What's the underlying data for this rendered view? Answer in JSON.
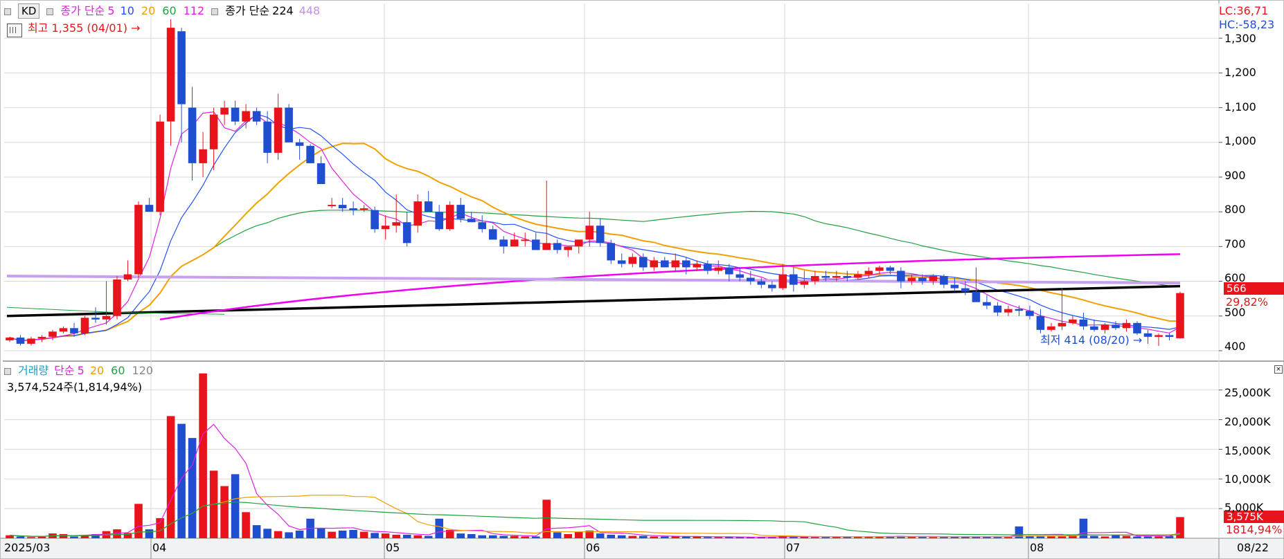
{
  "price_legend": {
    "button": "KD",
    "ma_label": "종가 단순",
    "ma_periods": [
      "5",
      "10",
      "20",
      "60",
      "112"
    ],
    "ma_colors": [
      "#e020e0",
      "#2050ff",
      "#f0a000",
      "#20a040",
      "#e020e0"
    ],
    "ma2_label": "종가 단순",
    "ma2_periods": [
      "224",
      "448"
    ]
  },
  "high_note": "최고 1,355 (04/01) →",
  "low_note": "최저 414 (08/20) →",
  "lc_text": "LC:36,71",
  "hc_text": "HC:-58,23",
  "price_tag": "566",
  "price_change": "29,82%",
  "volume_legend": {
    "label": "거래량",
    "ma_label": "단순",
    "periods": [
      "5",
      "20",
      "60",
      "120"
    ]
  },
  "volume_info": "3,574,524주(1,814,94%)",
  "volume_tag": "3,575K",
  "volume_change": "1814,94%",
  "x_axis_labels": [
    "2025/03",
    "04",
    "05",
    "06",
    "07",
    "08"
  ],
  "x_end_label": "08/22",
  "price_axis_ticks": [
    "1,300",
    "1,200",
    "1,100",
    "1,000",
    "900",
    "800",
    "700",
    "600",
    "500",
    "400"
  ],
  "volume_axis_ticks": [
    "25,000K",
    "20,000K",
    "15,000K",
    "10,000K",
    "5,000K"
  ],
  "chart_data": {
    "type": "candlestick",
    "period": "2025/03 - 08/22",
    "price_ylim": [
      370,
      1400
    ],
    "volume_ylim": [
      0,
      28000
    ],
    "ohlc_note": "approximate daily candles read from chart",
    "candles": [
      [
        430,
        440,
        425,
        438
      ],
      [
        438,
        445,
        415,
        420
      ],
      [
        420,
        440,
        415,
        435
      ],
      [
        435,
        445,
        425,
        440
      ],
      [
        440,
        460,
        430,
        455
      ],
      [
        455,
        470,
        450,
        465
      ],
      [
        465,
        480,
        440,
        450
      ],
      [
        450,
        500,
        445,
        495
      ],
      [
        495,
        525,
        480,
        490
      ],
      [
        490,
        600,
        475,
        500
      ],
      [
        500,
        615,
        490,
        605
      ],
      [
        605,
        660,
        600,
        620
      ],
      [
        620,
        830,
        610,
        820
      ],
      [
        820,
        840,
        800,
        800
      ],
      [
        800,
        1080,
        790,
        1060
      ],
      [
        1060,
        1355,
        990,
        1330
      ],
      [
        1320,
        1330,
        1000,
        1110
      ],
      [
        1100,
        1160,
        890,
        940
      ],
      [
        940,
        1030,
        900,
        980
      ],
      [
        980,
        1100,
        920,
        1080
      ],
      [
        1080,
        1120,
        1050,
        1100
      ],
      [
        1100,
        1120,
        1050,
        1060
      ],
      [
        1060,
        1110,
        1040,
        1090
      ],
      [
        1090,
        1100,
        1050,
        1060
      ],
      [
        1060,
        1090,
        940,
        970
      ],
      [
        970,
        1140,
        950,
        1100
      ],
      [
        1100,
        1110,
        1030,
        1000
      ],
      [
        1000,
        1010,
        950,
        990
      ],
      [
        990,
        995,
        940,
        940
      ],
      [
        940,
        960,
        880,
        880
      ],
      [
        820,
        840,
        810,
        820
      ],
      [
        820,
        840,
        800,
        810
      ],
      [
        810,
        830,
        790,
        805
      ],
      [
        810,
        820,
        800,
        810
      ],
      [
        805,
        815,
        740,
        750
      ],
      [
        750,
        790,
        720,
        760
      ],
      [
        760,
        850,
        740,
        770
      ],
      [
        770,
        800,
        700,
        710
      ],
      [
        760,
        850,
        740,
        830
      ],
      [
        830,
        860,
        800,
        800
      ],
      [
        800,
        820,
        745,
        750
      ],
      [
        750,
        830,
        745,
        820
      ],
      [
        820,
        840,
        770,
        780
      ],
      [
        780,
        800,
        770,
        770
      ],
      [
        770,
        790,
        740,
        750
      ],
      [
        750,
        760,
        720,
        720
      ],
      [
        720,
        730,
        680,
        700
      ],
      [
        700,
        740,
        700,
        720
      ],
      [
        720,
        740,
        700,
        720
      ],
      [
        720,
        740,
        690,
        690
      ],
      [
        690,
        890,
        690,
        710
      ],
      [
        710,
        720,
        680,
        690
      ],
      [
        690,
        700,
        670,
        700
      ],
      [
        700,
        720,
        680,
        720
      ],
      [
        720,
        800,
        700,
        760
      ],
      [
        760,
        780,
        700,
        710
      ],
      [
        710,
        720,
        650,
        660
      ],
      [
        660,
        680,
        640,
        650
      ],
      [
        650,
        680,
        640,
        670
      ],
      [
        670,
        680,
        630,
        640
      ],
      [
        640,
        670,
        630,
        660
      ],
      [
        660,
        670,
        640,
        640
      ],
      [
        640,
        680,
        630,
        660
      ],
      [
        660,
        670,
        620,
        640
      ],
      [
        640,
        660,
        630,
        650
      ],
      [
        650,
        660,
        620,
        630
      ],
      [
        630,
        660,
        620,
        640
      ],
      [
        640,
        650,
        600,
        620
      ],
      [
        620,
        640,
        600,
        610
      ],
      [
        610,
        630,
        590,
        600
      ],
      [
        600,
        610,
        580,
        590
      ],
      [
        590,
        600,
        570,
        580
      ],
      [
        580,
        650,
        575,
        620
      ],
      [
        620,
        640,
        570,
        590
      ],
      [
        590,
        630,
        580,
        600
      ],
      [
        600,
        630,
        590,
        615
      ],
      [
        615,
        630,
        600,
        610
      ],
      [
        610,
        630,
        600,
        615
      ],
      [
        615,
        630,
        600,
        610
      ],
      [
        610,
        630,
        605,
        620
      ],
      [
        620,
        640,
        610,
        630
      ],
      [
        630,
        645,
        620,
        640
      ],
      [
        640,
        645,
        620,
        630
      ],
      [
        630,
        640,
        580,
        600
      ],
      [
        600,
        620,
        590,
        610
      ],
      [
        610,
        620,
        590,
        600
      ],
      [
        600,
        620,
        590,
        615
      ],
      [
        615,
        620,
        580,
        590
      ],
      [
        590,
        610,
        570,
        580
      ],
      [
        580,
        600,
        560,
        570
      ],
      [
        570,
        640,
        550,
        540
      ],
      [
        540,
        560,
        520,
        530
      ],
      [
        530,
        540,
        500,
        510
      ],
      [
        510,
        530,
        500,
        520
      ],
      [
        520,
        530,
        500,
        515
      ],
      [
        515,
        530,
        490,
        500
      ],
      [
        500,
        520,
        450,
        460
      ],
      [
        460,
        480,
        455,
        470
      ],
      [
        470,
        580,
        460,
        480
      ],
      [
        480,
        500,
        475,
        490
      ],
      [
        490,
        510,
        460,
        470
      ],
      [
        470,
        490,
        455,
        460
      ],
      [
        460,
        480,
        450,
        475
      ],
      [
        475,
        485,
        460,
        465
      ],
      [
        465,
        490,
        455,
        480
      ],
      [
        480,
        485,
        445,
        450
      ],
      [
        450,
        460,
        420,
        440
      ],
      [
        440,
        450,
        414,
        445
      ],
      [
        445,
        450,
        430,
        440
      ],
      [
        436,
        570,
        435,
        566
      ]
    ],
    "volumes": [
      500,
      300,
      200,
      250,
      800,
      700,
      300,
      500,
      700,
      1200,
      1500,
      900,
      5800,
      1500,
      3400,
      20600,
      19300,
      16900,
      27800,
      11400,
      8800,
      10800,
      4400,
      2200,
      1600,
      1200,
      1000,
      1300,
      3300,
      1700,
      1100,
      1300,
      1400,
      1100,
      900,
      800,
      600,
      600,
      500,
      400,
      3300,
      1400,
      800,
      700,
      500,
      500,
      400,
      400,
      300,
      300,
      6500,
      1000,
      700,
      1100,
      1300,
      800,
      600,
      500,
      400,
      400,
      300,
      300,
      300,
      300,
      300,
      200,
      200,
      200,
      200,
      200,
      200,
      200,
      400,
      300,
      300,
      200,
      200,
      200,
      300,
      300,
      300,
      300,
      300,
      400,
      300,
      300,
      200,
      200,
      300,
      300,
      300,
      300,
      200,
      200,
      2000,
      400,
      300,
      300,
      300,
      500,
      3300,
      400,
      300,
      600,
      400,
      300,
      300,
      300,
      400,
      3575
    ],
    "title": "",
    "xlabel": "",
    "ylabel": ""
  }
}
